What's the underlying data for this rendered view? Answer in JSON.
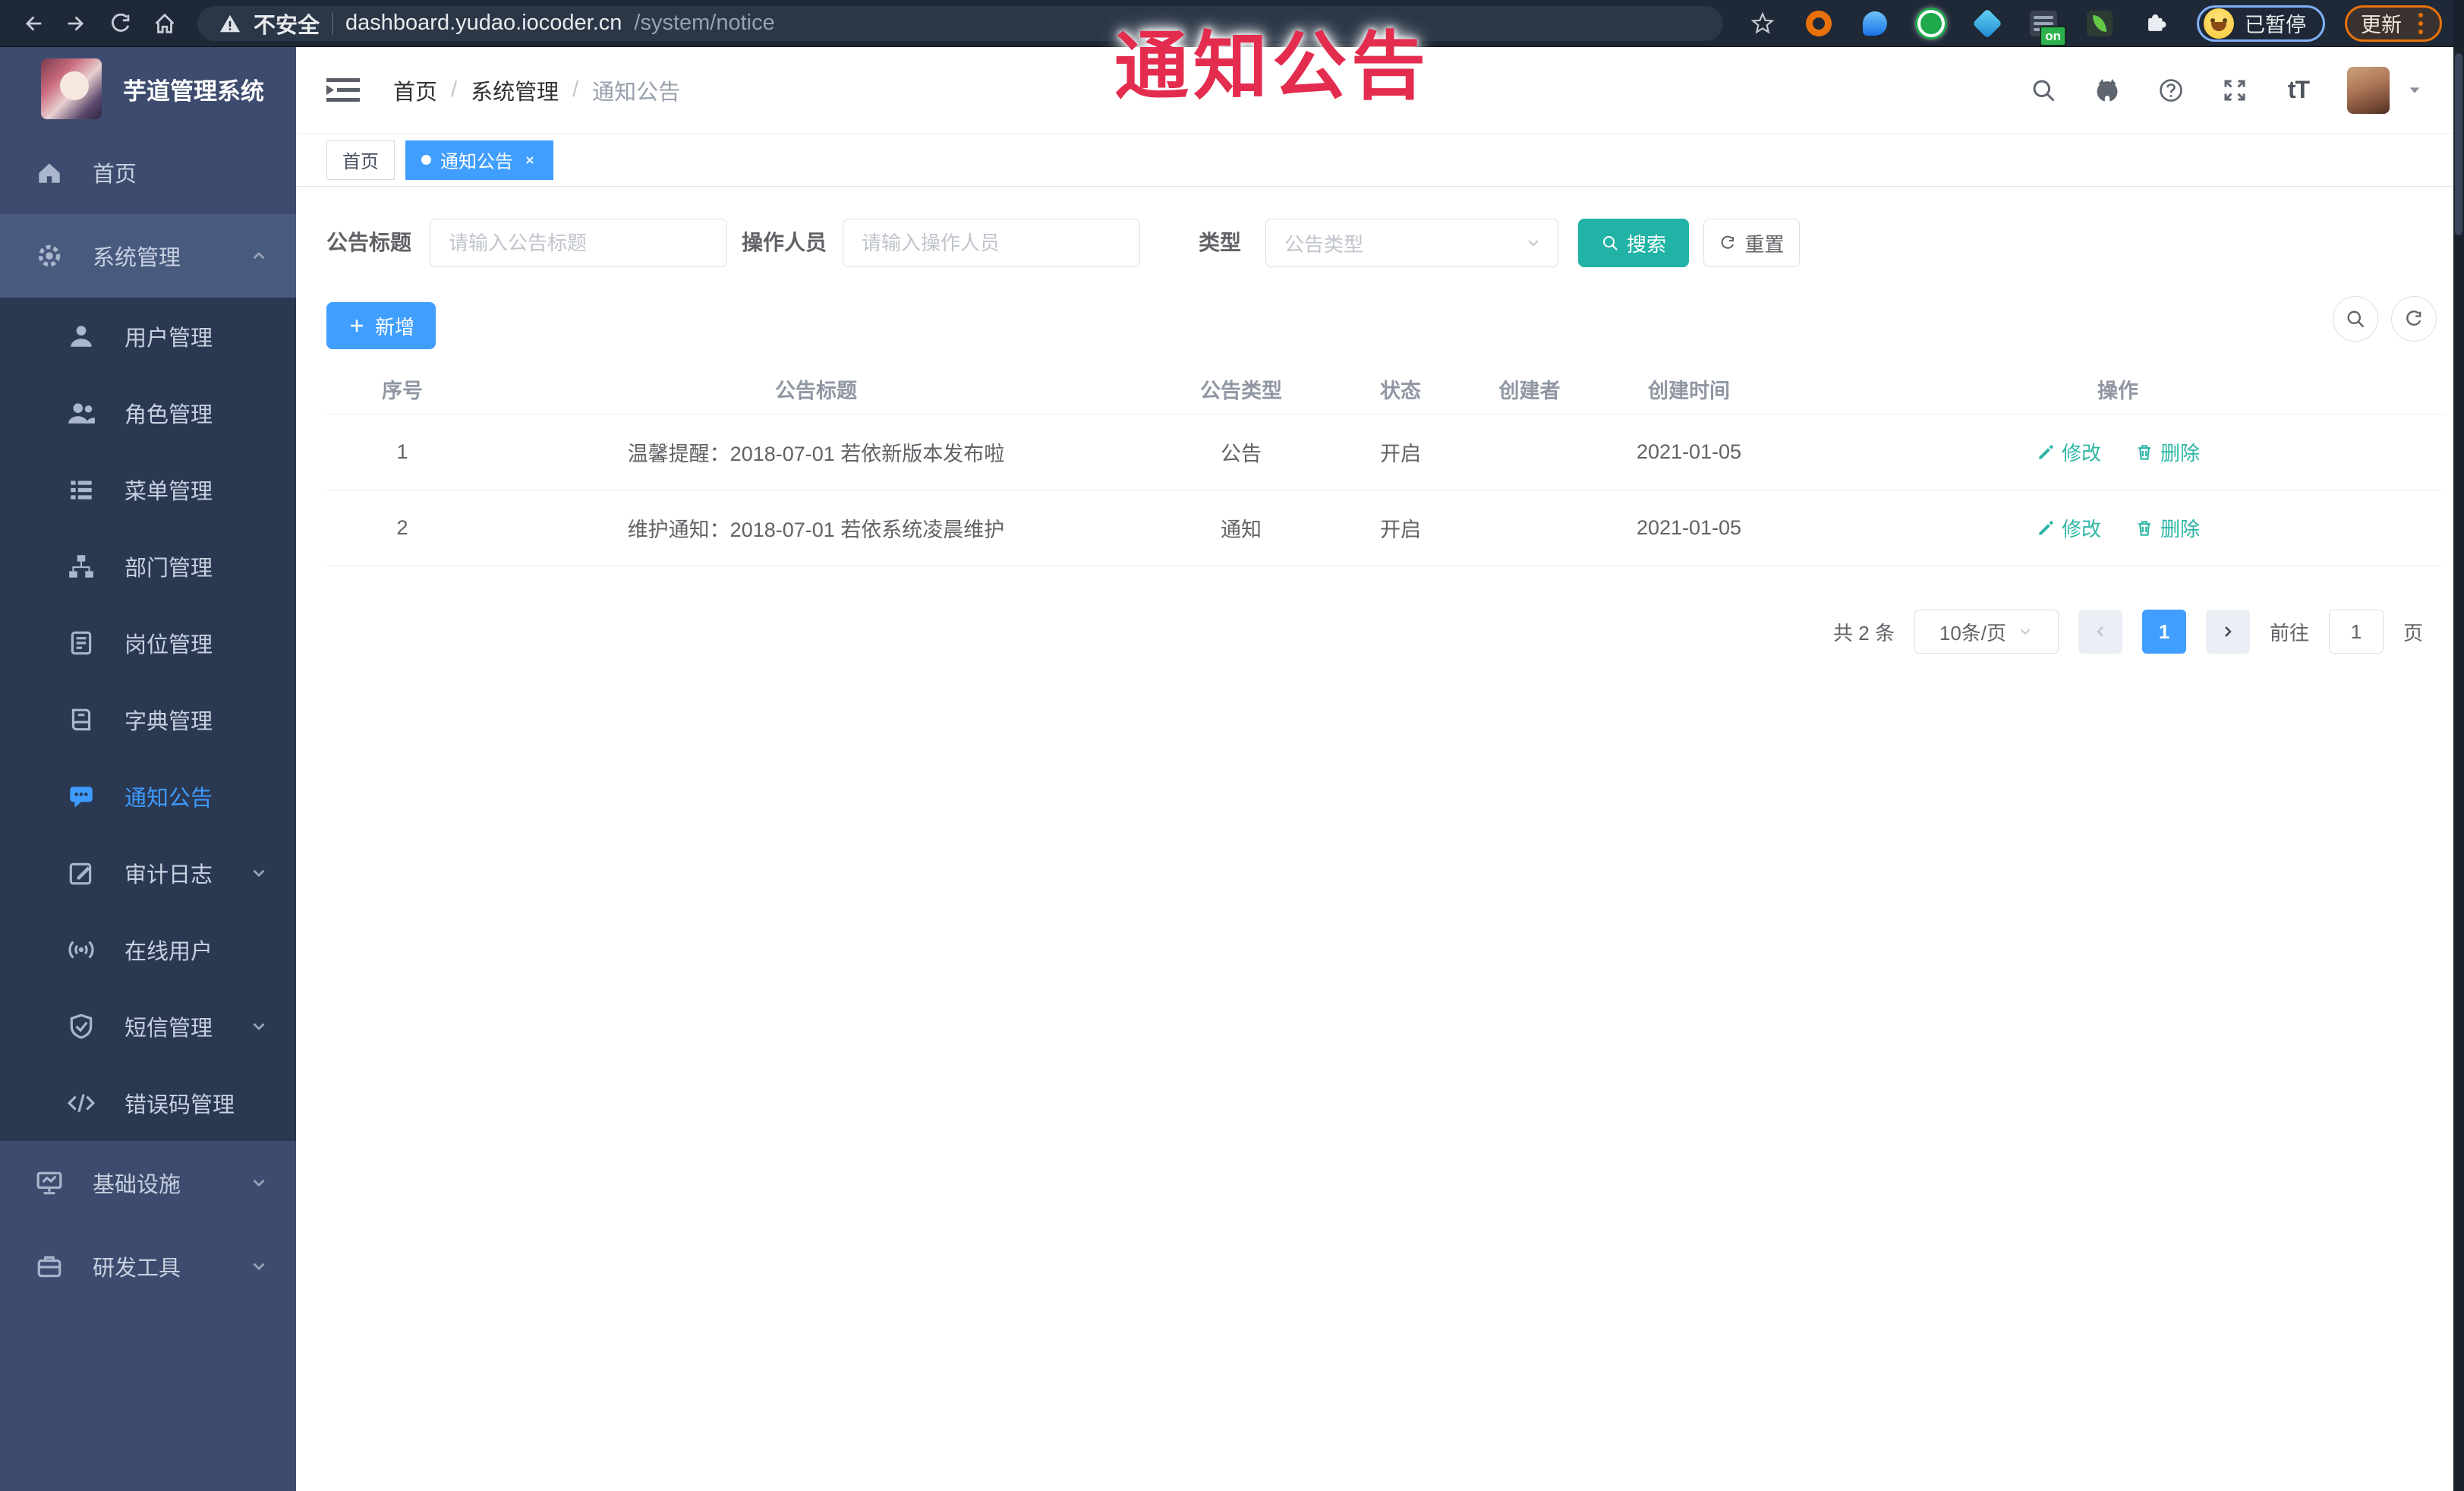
{
  "overlay": {
    "stamp_text": "通知公告"
  },
  "browser": {
    "security_label": "不安全",
    "url_host": "dashboard.yudao.iocoder.cn",
    "url_path": "/system/notice",
    "extension_badge": "on",
    "profile_label": "已暂停",
    "update_label": "更新"
  },
  "sidebar": {
    "app_title": "芋道管理系统",
    "items": [
      {
        "label": "首页",
        "level": 1
      },
      {
        "label": "系统管理",
        "level": 1,
        "expanded": true
      },
      {
        "label": "用户管理",
        "level": 2
      },
      {
        "label": "角色管理",
        "level": 2
      },
      {
        "label": "菜单管理",
        "level": 2
      },
      {
        "label": "部门管理",
        "level": 2
      },
      {
        "label": "岗位管理",
        "level": 2
      },
      {
        "label": "字典管理",
        "level": 2
      },
      {
        "label": "通知公告",
        "level": 2,
        "active": true
      },
      {
        "label": "审计日志",
        "level": 2,
        "collapsible": true
      },
      {
        "label": "在线用户",
        "level": 2
      },
      {
        "label": "短信管理",
        "level": 2,
        "collapsible": true
      },
      {
        "label": "错误码管理",
        "level": 2
      },
      {
        "label": "基础设施",
        "level": 1,
        "collapsible": true
      },
      {
        "label": "研发工具",
        "level": 1,
        "collapsible": true
      }
    ]
  },
  "header": {
    "breadcrumb": [
      "首页",
      "系统管理",
      "通知公告"
    ],
    "breadcrumb_separator": "/",
    "text_size_glyph": "tT"
  },
  "tabs": [
    {
      "label": "首页",
      "active": false
    },
    {
      "label": "通知公告",
      "active": true
    }
  ],
  "filters": {
    "title_label": "公告标题",
    "title_placeholder": "请输入公告标题",
    "operator_label": "操作人员",
    "operator_placeholder": "请输入操作人员",
    "type_label": "类型",
    "type_placeholder": "公告类型",
    "search_label": "搜索",
    "reset_label": "重置"
  },
  "toolbar": {
    "add_label": "新增"
  },
  "table": {
    "headers": [
      "序号",
      "公告标题",
      "公告类型",
      "状态",
      "创建者",
      "创建时间",
      "操作"
    ],
    "edit_label": "修改",
    "delete_label": "删除",
    "rows": [
      {
        "no": "1",
        "title": "温馨提醒：2018-07-01 若依新版本发布啦",
        "type": "公告",
        "status": "开启",
        "creator": "",
        "created": "2021-01-05"
      },
      {
        "no": "2",
        "title": "维护通知：2018-07-01 若依系统凌晨维护",
        "type": "通知",
        "status": "开启",
        "creator": "",
        "created": "2021-01-05"
      }
    ]
  },
  "pagination": {
    "total": "共 2 条",
    "page_size": "10条/页",
    "current_page": "1",
    "goto_label": "前往",
    "goto_value": "1",
    "page_unit": "页"
  },
  "colors": {
    "accent_blue": "#409eff",
    "accent_teal": "#21b3a6",
    "stamp_red": "#e32c4e",
    "sidebar_bg": "#3d4c6e",
    "submenu_bg": "#2a3852",
    "browser_bar_bg": "#1e2836"
  }
}
